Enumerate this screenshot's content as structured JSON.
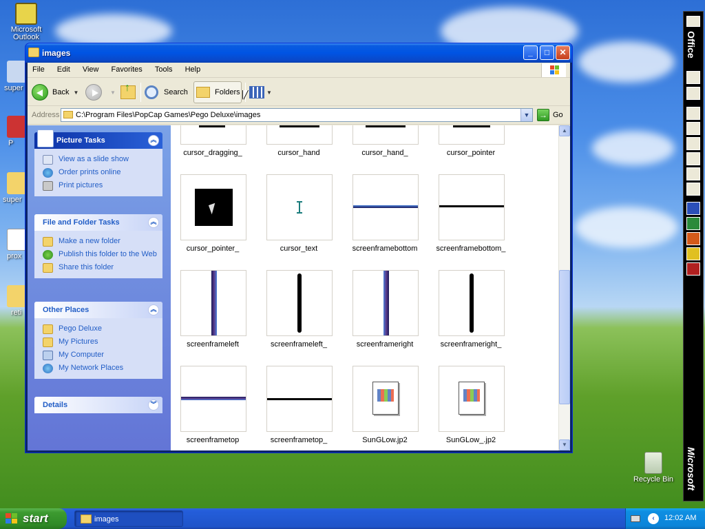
{
  "desktop": {
    "icons": [
      {
        "label": "Microsoft Outlook"
      },
      {
        "label": "super"
      },
      {
        "label": "P"
      },
      {
        "label": "super"
      },
      {
        "label": "prox"
      },
      {
        "label": "reti"
      },
      {
        "label": "Recycle Bin"
      }
    ]
  },
  "window": {
    "title": "images",
    "controls": {
      "minimize": "_",
      "maximize": "□",
      "close": "✕"
    }
  },
  "menubar": [
    "File",
    "Edit",
    "View",
    "Favorites",
    "Tools",
    "Help"
  ],
  "toolbar": {
    "back": "Back",
    "search": "Search",
    "folders": "Folders"
  },
  "address": {
    "label": "Address",
    "value": "C:\\Program Files\\PopCap Games\\Pego Deluxe\\images",
    "go": "Go"
  },
  "taskpane": {
    "picture_tasks": {
      "title": "Picture Tasks",
      "items": [
        "View as a slide show",
        "Order prints online",
        "Print pictures"
      ]
    },
    "file_folder_tasks": {
      "title": "File and Folder Tasks",
      "items": [
        "Make a new folder",
        "Publish this folder to the Web",
        "Share this folder"
      ]
    },
    "other_places": {
      "title": "Other Places",
      "items": [
        "Pego Deluxe",
        "My Pictures",
        "My Computer",
        "My Network Places"
      ]
    },
    "details": {
      "title": "Details"
    }
  },
  "files": [
    {
      "name": "cursor_dragging_"
    },
    {
      "name": "cursor_hand"
    },
    {
      "name": "cursor_hand_"
    },
    {
      "name": "cursor_pointer"
    },
    {
      "name": "cursor_pointer_"
    },
    {
      "name": "cursor_text"
    },
    {
      "name": "screenframebottom"
    },
    {
      "name": "screenframebottom_"
    },
    {
      "name": "screenframeleft"
    },
    {
      "name": "screenframeleft_"
    },
    {
      "name": "screenframeright"
    },
    {
      "name": "screenframeright_"
    },
    {
      "name": "screenframetop"
    },
    {
      "name": "screenframetop_"
    },
    {
      "name": "SunGLow.jp2"
    },
    {
      "name": "SunGLow_.jp2"
    }
  ],
  "officebar": {
    "top_label": "Office",
    "bottom_label": "Microsoft"
  },
  "taskbar": {
    "start": "start",
    "task": "images",
    "clock": "12:02 AM"
  },
  "colors": {
    "xp_blue": "#0054e3",
    "taskpane_link": "#215dc6",
    "start_green": "#3c9a30"
  }
}
